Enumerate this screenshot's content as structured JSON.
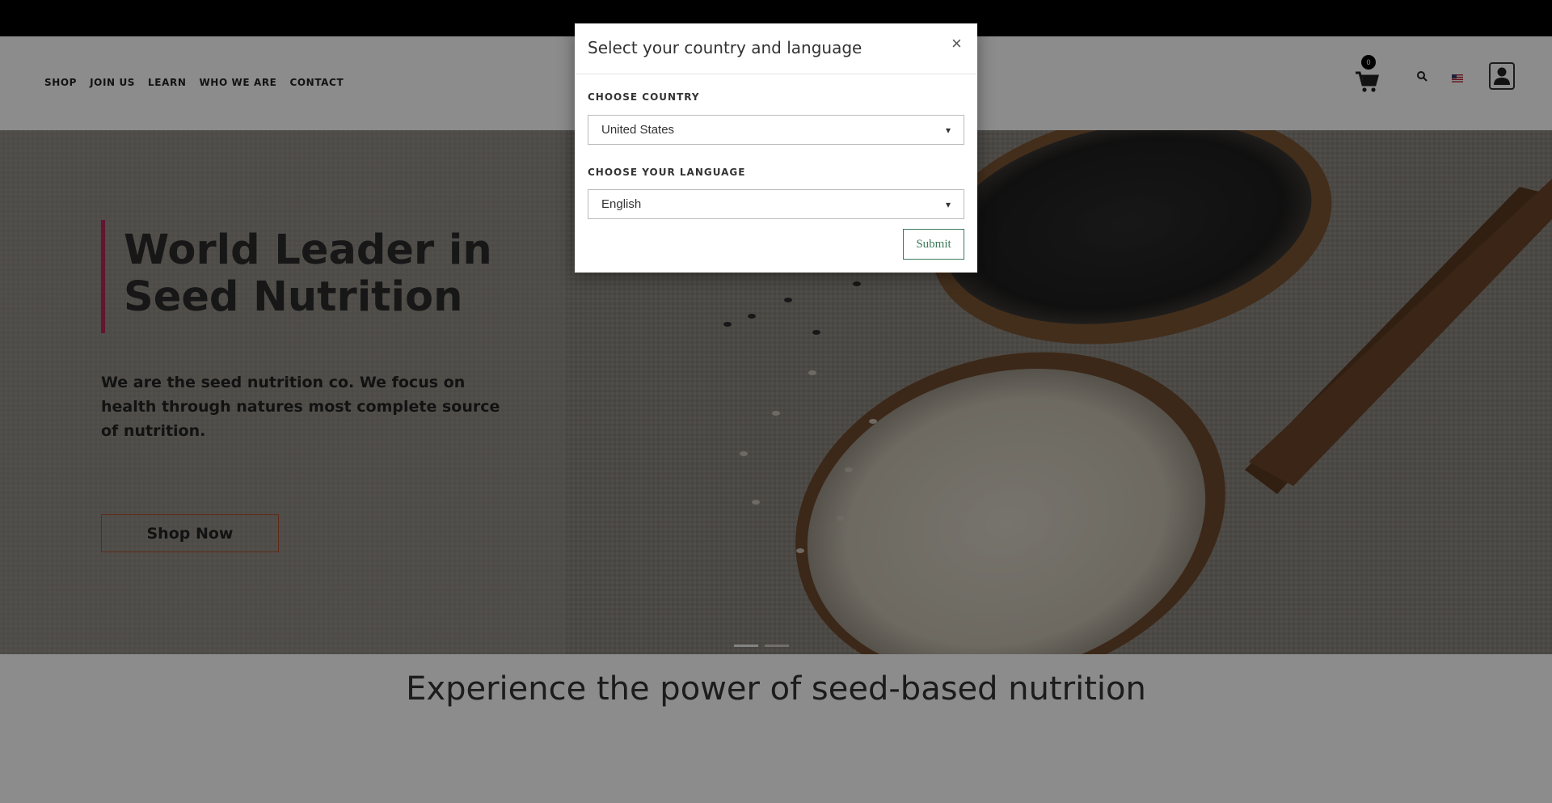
{
  "nav": {
    "items": [
      {
        "label": "SHOP"
      },
      {
        "label": "JOIN US"
      },
      {
        "label": "LEARN"
      },
      {
        "label": "WHO WE ARE"
      },
      {
        "label": "CONTACT"
      }
    ]
  },
  "header": {
    "cart_count": "0",
    "icons": [
      "cart-icon",
      "search-icon",
      "us-flag-icon",
      "user-icon"
    ]
  },
  "hero": {
    "title": "World Leader in Seed Nutrition",
    "text": "We are the seed nutrition co. We focus on health through natures most complete source of nutrition.",
    "button_label": "Shop Now",
    "accent_color": "#b5275b"
  },
  "tagline": "Experience the power of seed-based nutrition",
  "modal": {
    "title": "Select your country and language",
    "close_label": "×",
    "country_label": "CHOOSE COUNTRY",
    "country_value": "United States",
    "language_label": "CHOOSE YOUR LANGUAGE",
    "language_value": "English",
    "submit_label": "Submit"
  }
}
